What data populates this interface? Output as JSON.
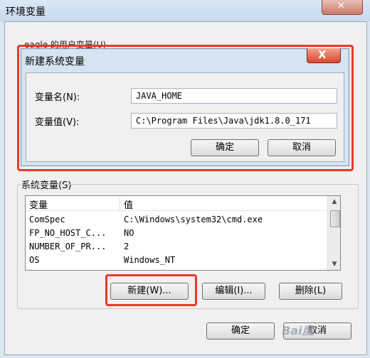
{
  "outer_window": {
    "title": "环境变量",
    "user_vars_label": "eagle 的用户变量(U)",
    "ok_label": "确定",
    "cancel_label": "取消"
  },
  "new_var_dialog": {
    "title": "新建系统变量",
    "close_glyph": "X",
    "name_label": "变量名(N):",
    "name_value": "JAVA_HOME",
    "value_label": "变量值(V):",
    "value_value": "C:\\Program Files\\Java\\jdk1.8.0_171",
    "ok_label": "确定",
    "cancel_label": "取消"
  },
  "system_vars": {
    "label": "系统变量(S)",
    "columns": [
      "变量",
      "值"
    ],
    "rows": [
      {
        "name": "ComSpec",
        "value": "C:\\Windows\\system32\\cmd.exe"
      },
      {
        "name": "FP_NO_HOST_C...",
        "value": "NO"
      },
      {
        "name": "NUMBER_OF_PR...",
        "value": "2"
      },
      {
        "name": "OS",
        "value": "Windows_NT"
      }
    ],
    "new_label": "新建(W)...",
    "edit_label": "编辑(I)...",
    "delete_label": "删除(L)"
  },
  "watermark": "Bai度"
}
